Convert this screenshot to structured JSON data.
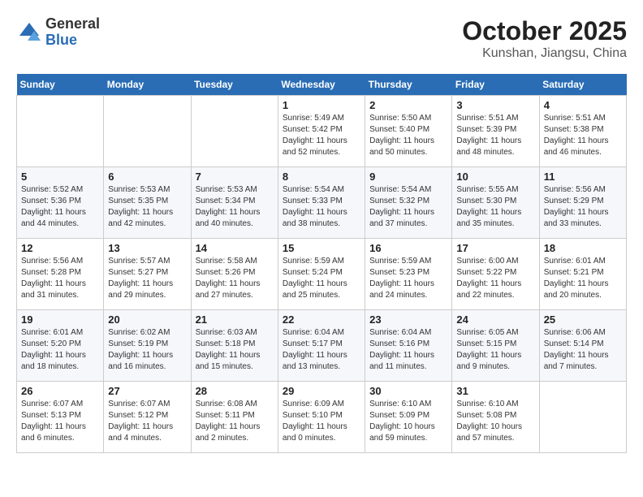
{
  "logo": {
    "general": "General",
    "blue": "Blue"
  },
  "title": "October 2025",
  "location": "Kunshan, Jiangsu, China",
  "days_header": [
    "Sunday",
    "Monday",
    "Tuesday",
    "Wednesday",
    "Thursday",
    "Friday",
    "Saturday"
  ],
  "weeks": [
    [
      {
        "day": "",
        "info": ""
      },
      {
        "day": "",
        "info": ""
      },
      {
        "day": "",
        "info": ""
      },
      {
        "day": "1",
        "info": "Sunrise: 5:49 AM\nSunset: 5:42 PM\nDaylight: 11 hours\nand 52 minutes."
      },
      {
        "day": "2",
        "info": "Sunrise: 5:50 AM\nSunset: 5:40 PM\nDaylight: 11 hours\nand 50 minutes."
      },
      {
        "day": "3",
        "info": "Sunrise: 5:51 AM\nSunset: 5:39 PM\nDaylight: 11 hours\nand 48 minutes."
      },
      {
        "day": "4",
        "info": "Sunrise: 5:51 AM\nSunset: 5:38 PM\nDaylight: 11 hours\nand 46 minutes."
      }
    ],
    [
      {
        "day": "5",
        "info": "Sunrise: 5:52 AM\nSunset: 5:36 PM\nDaylight: 11 hours\nand 44 minutes."
      },
      {
        "day": "6",
        "info": "Sunrise: 5:53 AM\nSunset: 5:35 PM\nDaylight: 11 hours\nand 42 minutes."
      },
      {
        "day": "7",
        "info": "Sunrise: 5:53 AM\nSunset: 5:34 PM\nDaylight: 11 hours\nand 40 minutes."
      },
      {
        "day": "8",
        "info": "Sunrise: 5:54 AM\nSunset: 5:33 PM\nDaylight: 11 hours\nand 38 minutes."
      },
      {
        "day": "9",
        "info": "Sunrise: 5:54 AM\nSunset: 5:32 PM\nDaylight: 11 hours\nand 37 minutes."
      },
      {
        "day": "10",
        "info": "Sunrise: 5:55 AM\nSunset: 5:30 PM\nDaylight: 11 hours\nand 35 minutes."
      },
      {
        "day": "11",
        "info": "Sunrise: 5:56 AM\nSunset: 5:29 PM\nDaylight: 11 hours\nand 33 minutes."
      }
    ],
    [
      {
        "day": "12",
        "info": "Sunrise: 5:56 AM\nSunset: 5:28 PM\nDaylight: 11 hours\nand 31 minutes."
      },
      {
        "day": "13",
        "info": "Sunrise: 5:57 AM\nSunset: 5:27 PM\nDaylight: 11 hours\nand 29 minutes."
      },
      {
        "day": "14",
        "info": "Sunrise: 5:58 AM\nSunset: 5:26 PM\nDaylight: 11 hours\nand 27 minutes."
      },
      {
        "day": "15",
        "info": "Sunrise: 5:59 AM\nSunset: 5:24 PM\nDaylight: 11 hours\nand 25 minutes."
      },
      {
        "day": "16",
        "info": "Sunrise: 5:59 AM\nSunset: 5:23 PM\nDaylight: 11 hours\nand 24 minutes."
      },
      {
        "day": "17",
        "info": "Sunrise: 6:00 AM\nSunset: 5:22 PM\nDaylight: 11 hours\nand 22 minutes."
      },
      {
        "day": "18",
        "info": "Sunrise: 6:01 AM\nSunset: 5:21 PM\nDaylight: 11 hours\nand 20 minutes."
      }
    ],
    [
      {
        "day": "19",
        "info": "Sunrise: 6:01 AM\nSunset: 5:20 PM\nDaylight: 11 hours\nand 18 minutes."
      },
      {
        "day": "20",
        "info": "Sunrise: 6:02 AM\nSunset: 5:19 PM\nDaylight: 11 hours\nand 16 minutes."
      },
      {
        "day": "21",
        "info": "Sunrise: 6:03 AM\nSunset: 5:18 PM\nDaylight: 11 hours\nand 15 minutes."
      },
      {
        "day": "22",
        "info": "Sunrise: 6:04 AM\nSunset: 5:17 PM\nDaylight: 11 hours\nand 13 minutes."
      },
      {
        "day": "23",
        "info": "Sunrise: 6:04 AM\nSunset: 5:16 PM\nDaylight: 11 hours\nand 11 minutes."
      },
      {
        "day": "24",
        "info": "Sunrise: 6:05 AM\nSunset: 5:15 PM\nDaylight: 11 hours\nand 9 minutes."
      },
      {
        "day": "25",
        "info": "Sunrise: 6:06 AM\nSunset: 5:14 PM\nDaylight: 11 hours\nand 7 minutes."
      }
    ],
    [
      {
        "day": "26",
        "info": "Sunrise: 6:07 AM\nSunset: 5:13 PM\nDaylight: 11 hours\nand 6 minutes."
      },
      {
        "day": "27",
        "info": "Sunrise: 6:07 AM\nSunset: 5:12 PM\nDaylight: 11 hours\nand 4 minutes."
      },
      {
        "day": "28",
        "info": "Sunrise: 6:08 AM\nSunset: 5:11 PM\nDaylight: 11 hours\nand 2 minutes."
      },
      {
        "day": "29",
        "info": "Sunrise: 6:09 AM\nSunset: 5:10 PM\nDaylight: 11 hours\nand 0 minutes."
      },
      {
        "day": "30",
        "info": "Sunrise: 6:10 AM\nSunset: 5:09 PM\nDaylight: 10 hours\nand 59 minutes."
      },
      {
        "day": "31",
        "info": "Sunrise: 6:10 AM\nSunset: 5:08 PM\nDaylight: 10 hours\nand 57 minutes."
      },
      {
        "day": "",
        "info": ""
      }
    ]
  ]
}
